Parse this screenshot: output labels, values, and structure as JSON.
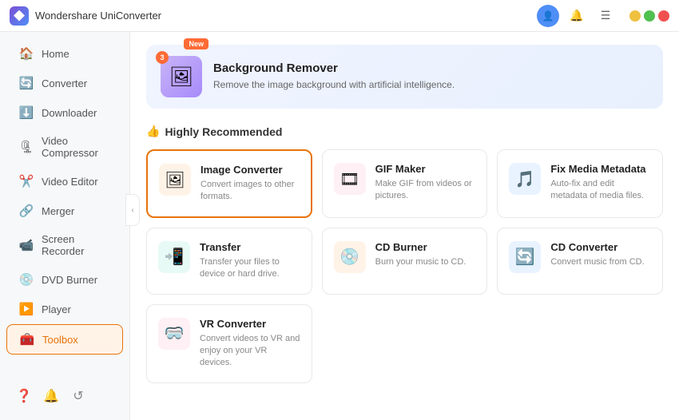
{
  "titleBar": {
    "appName": "Wondershare UniConverter",
    "windowControls": {
      "minimize": "−",
      "maximize": "□",
      "close": "×"
    }
  },
  "sidebar": {
    "items": [
      {
        "id": "home",
        "label": "Home",
        "icon": "🏠"
      },
      {
        "id": "converter",
        "label": "Converter",
        "icon": "🔄"
      },
      {
        "id": "downloader",
        "label": "Downloader",
        "icon": "⬇️"
      },
      {
        "id": "video-compressor",
        "label": "Video Compressor",
        "icon": "🗜"
      },
      {
        "id": "video-editor",
        "label": "Video Editor",
        "icon": "✂️"
      },
      {
        "id": "merger",
        "label": "Merger",
        "icon": "🔗"
      },
      {
        "id": "screen-recorder",
        "label": "Screen Recorder",
        "icon": "📹"
      },
      {
        "id": "dvd-burner",
        "label": "DVD Burner",
        "icon": "💿"
      },
      {
        "id": "player",
        "label": "Player",
        "icon": "▶️"
      },
      {
        "id": "toolbox",
        "label": "Toolbox",
        "icon": "🧰",
        "active": true
      }
    ],
    "bottomIcons": [
      "❓",
      "🔔",
      "↺"
    ]
  },
  "banner": {
    "badge": "New",
    "badgeNum": "3",
    "title": "Background Remover",
    "description": "Remove the image background with artificial intelligence.",
    "icon": "🖼"
  },
  "recommended": {
    "sectionTitle": "Highly Recommended",
    "sectionIcon": "👍",
    "tools": [
      {
        "id": "image-converter",
        "title": "Image Converter",
        "description": "Convert images to other formats.",
        "icon": "🖼",
        "iconStyle": "orange",
        "highlighted": true
      },
      {
        "id": "gif-maker",
        "title": "GIF Maker",
        "description": "Make GIF from videos or pictures.",
        "icon": "🎞",
        "iconStyle": "pink",
        "highlighted": false
      },
      {
        "id": "fix-media-metadata",
        "title": "Fix Media Metadata",
        "description": "Auto-fix and edit metadata of media files.",
        "icon": "🎵",
        "iconStyle": "blue",
        "highlighted": false
      },
      {
        "id": "transfer",
        "title": "Transfer",
        "description": "Transfer your files to device or hard drive.",
        "icon": "📲",
        "iconStyle": "teal",
        "highlighted": false
      },
      {
        "id": "cd-burner",
        "title": "CD Burner",
        "description": "Burn your music to CD.",
        "icon": "💿",
        "iconStyle": "orange",
        "highlighted": false
      },
      {
        "id": "cd-converter",
        "title": "CD Converter",
        "description": "Convert music from CD.",
        "icon": "🔄",
        "iconStyle": "blue",
        "highlighted": false
      }
    ]
  },
  "vrConverter": {
    "id": "vr-converter",
    "title": "VR Converter",
    "description": "Convert videos to VR and enjoy on your VR devices.",
    "icon": "🥽",
    "iconStyle": "pink"
  }
}
